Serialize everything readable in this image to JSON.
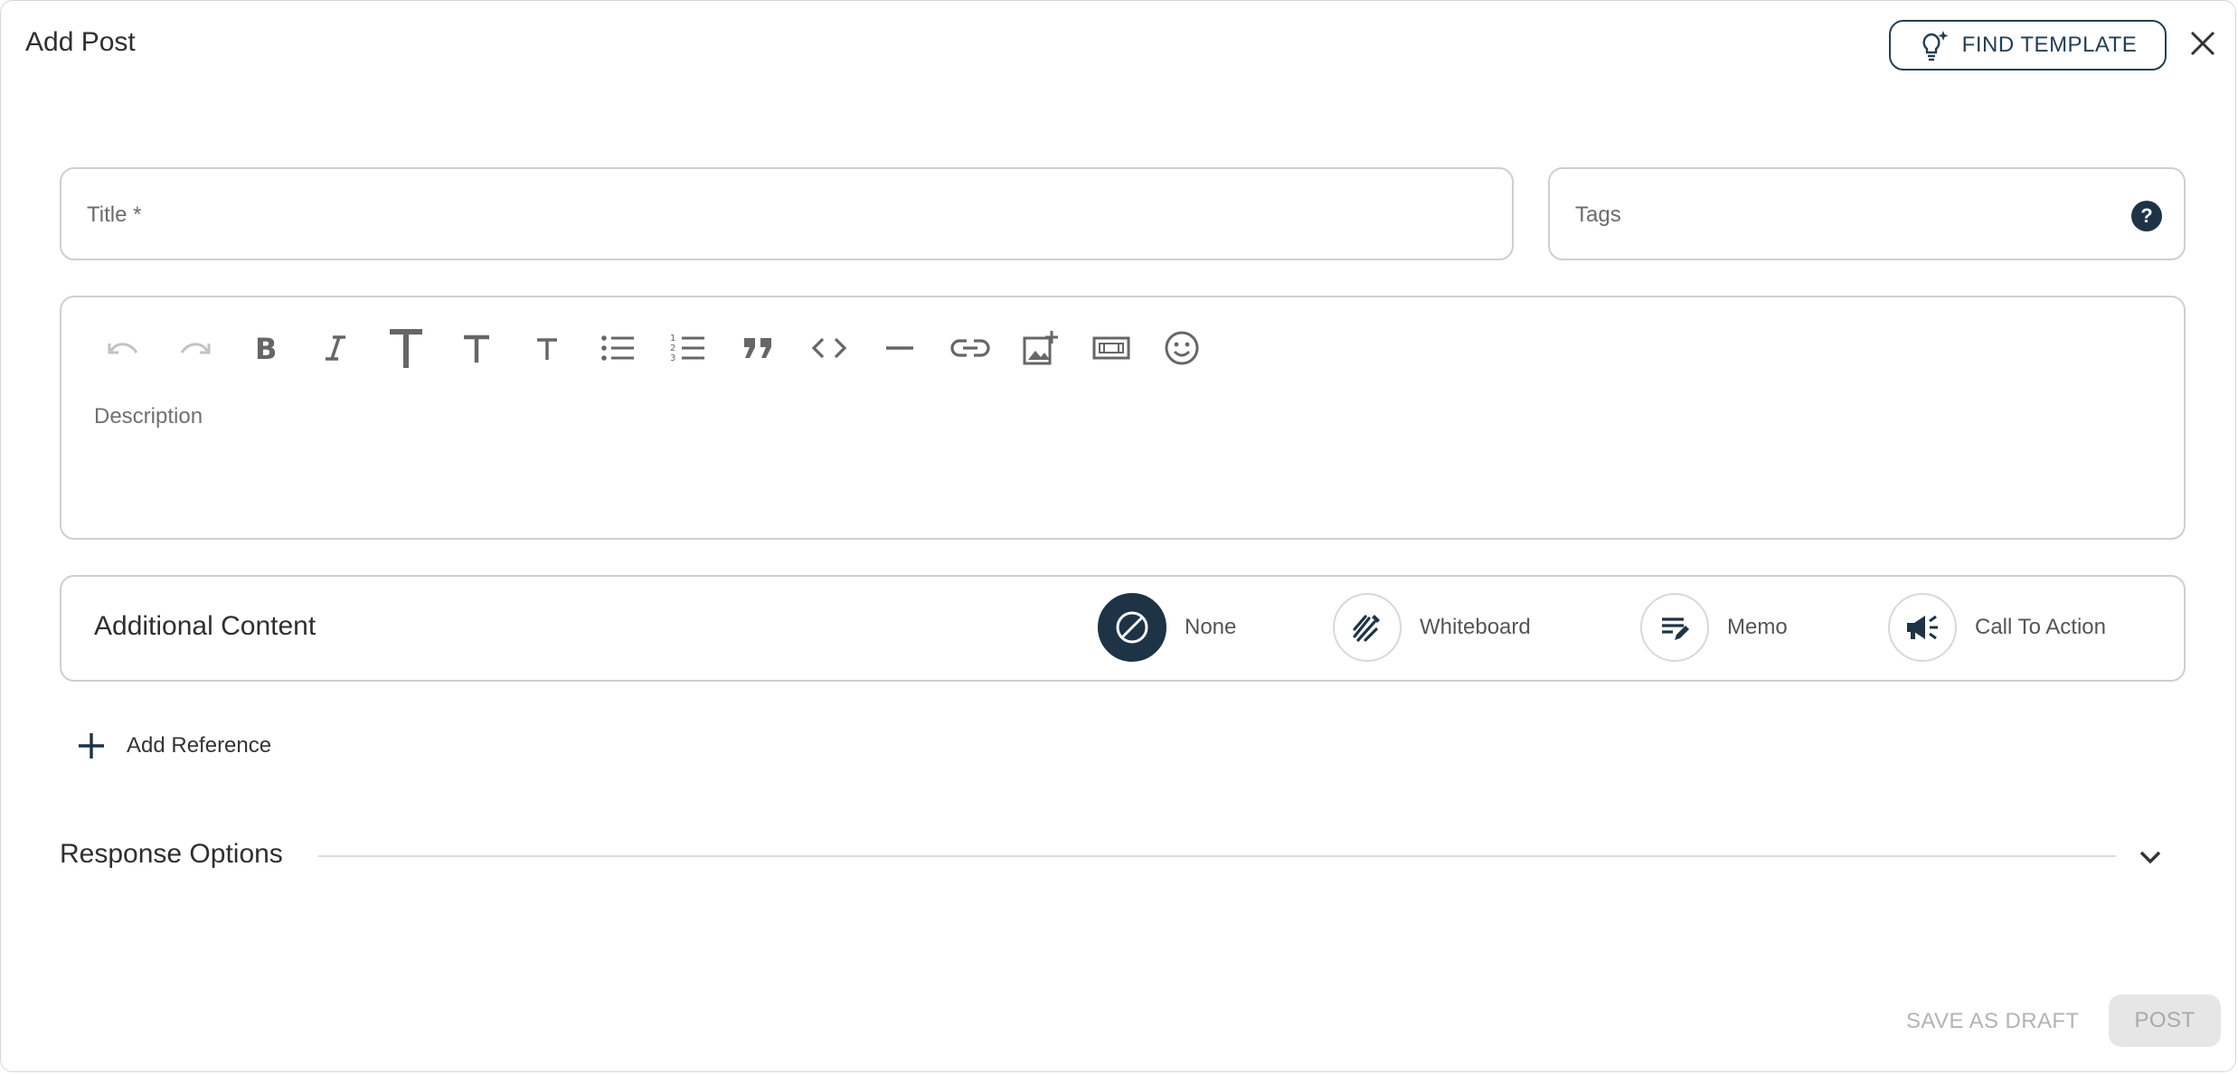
{
  "dialog": {
    "title": "Add Post",
    "find_template_label": "FIND TEMPLATE"
  },
  "form": {
    "title_placeholder": "Title *",
    "tags_placeholder": "Tags",
    "tags_help": "?",
    "description_placeholder": "Description"
  },
  "toolbar": {
    "tools": [
      "undo-icon",
      "redo-icon",
      "bold-icon",
      "italic-icon",
      "heading-1-icon",
      "heading-2-icon",
      "heading-3-icon",
      "bulleted-list-icon",
      "numbered-list-icon",
      "quote-icon",
      "code-icon",
      "horizontal-rule-icon",
      "link-icon",
      "add-image-icon",
      "embed-icon",
      "emoji-icon"
    ]
  },
  "additional_content": {
    "title": "Additional Content",
    "options": [
      {
        "label": "None",
        "icon": "none-icon",
        "selected": true
      },
      {
        "label": "Whiteboard",
        "icon": "whiteboard-icon",
        "selected": false
      },
      {
        "label": "Memo",
        "icon": "memo-icon",
        "selected": false
      },
      {
        "label": "Call To Action",
        "icon": "megaphone-icon",
        "selected": false
      }
    ]
  },
  "references": {
    "add_label": "Add Reference"
  },
  "response_options": {
    "label": "Response Options"
  },
  "footer": {
    "save_draft_label": "SAVE AS DRAFT",
    "post_label": "POST"
  },
  "colors": {
    "primary": "#1f3346",
    "border": "#cfcfcf",
    "disabled_text": "#b3b3b3",
    "disabled_bg": "#e6e6e6"
  }
}
